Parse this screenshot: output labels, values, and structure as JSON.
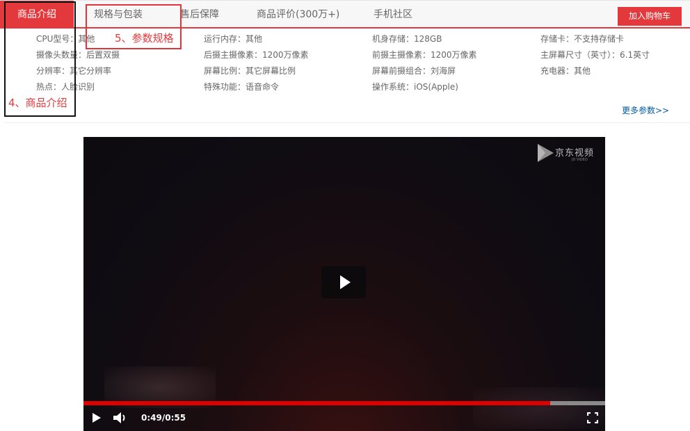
{
  "tabs": [
    {
      "label": "商品介绍",
      "active": true
    },
    {
      "label": "规格与包装",
      "active": false
    },
    {
      "label": "售后保障",
      "active": false
    },
    {
      "label": "商品评价(300万+)",
      "active": false
    },
    {
      "label": "手机社区",
      "active": false
    }
  ],
  "cart_button": "加入购物车",
  "specs": [
    "CPU型号：其他",
    "运行内存：其他",
    "机身存储：128GB",
    "存储卡：不支持存储卡",
    "摄像头数量：后置双摄",
    "后摄主摄像素：1200万像素",
    "前摄主摄像素：1200万像素",
    "主屏幕尺寸（英寸）：6.1英寸",
    "分辨率：其它分辨率",
    "屏幕比例：其它屏幕比例",
    "屏幕前摄组合：刘海屏",
    "充电器：其他",
    "热点：人脸识别",
    "特殊功能：语音命令",
    "操作系统：iOS(Apple)"
  ],
  "more_params": "更多参数>>",
  "annotations": {
    "product_intro": "4、商品介绍",
    "spec_params": "5、参数规格"
  },
  "video": {
    "watermark": "京东视频",
    "watermark_sub": "JD VIDEO",
    "time_text": "0:49/0:55",
    "progress": 0.894
  },
  "colors": {
    "accent": "#e4393c",
    "link": "#005aa0",
    "progress": "#e00000"
  }
}
